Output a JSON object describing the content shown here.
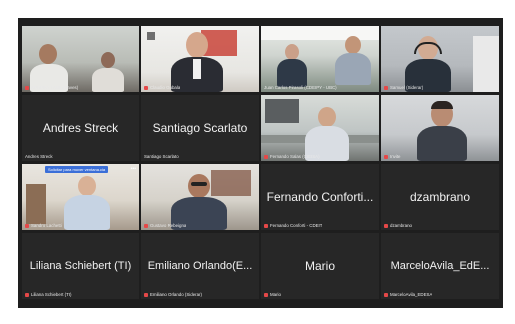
{
  "tiles": [
    {
      "tag": "ANDRES TAMI (Claves)",
      "big": "",
      "video": true
    },
    {
      "tag": "Claudio Gubala",
      "big": "",
      "video": true
    },
    {
      "tag": "Juan Carlos Pirasoli (CDEIPY - UBC)",
      "big": "",
      "video": true,
      "speaking": true
    },
    {
      "tag": "Samuel (Siderar)",
      "big": "",
      "video": true
    },
    {
      "tag": "Andres Streck",
      "big": "Andres Streck",
      "video": false
    },
    {
      "tag": "Santiago Scarlato",
      "big": "Santiago Scarlato",
      "video": false
    },
    {
      "tag": "Fernando Salas (CIEISA)",
      "big": "",
      "video": true
    },
    {
      "tag": "Invite",
      "big": "",
      "video": true
    },
    {
      "tag": "Sandro Lachetti",
      "big": "",
      "video": true,
      "pin": "Solicitar para mover ventana.cia",
      "more": "•••"
    },
    {
      "tag": "Gustavo Rebeigna",
      "big": "",
      "video": true
    },
    {
      "tag": "Fernando Conforti - CDEIT",
      "big": "Fernando Conforti...",
      "video": false
    },
    {
      "tag": "dzambrano",
      "big": "dzambrano",
      "video": false
    },
    {
      "tag": "Liliana Schiebert (TI)",
      "big": "Liliana Schiebert (TI)",
      "video": false
    },
    {
      "tag": "Emiliano Orlando (Siderar)",
      "big": "Emiliano Orlando(E...",
      "video": false
    },
    {
      "tag": "Mario",
      "big": "Mario",
      "video": false
    },
    {
      "tag": "MarceloAvila_EDESA",
      "big": "MarceloAvila_EdE...",
      "video": false
    }
  ],
  "colors": {
    "frame": "#1e1e1e",
    "tile": "#272727",
    "speaking": "#5fd05f",
    "muted": "#e54848"
  }
}
